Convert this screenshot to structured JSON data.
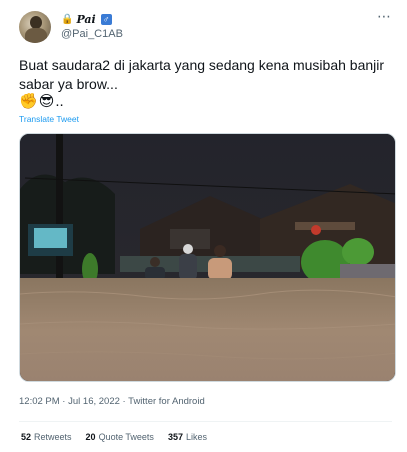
{
  "user": {
    "avatar_icon": "user-avatar-photo",
    "lock_emoji": "🔒",
    "display_name": "Pai",
    "gender_badge": "♂",
    "handle": "@Pai_C1AB"
  },
  "more_icon": "⋯",
  "tweet": {
    "text": "Buat saudara2 di jakarta yang sedang kena musibah banjir sabar ya brow...",
    "emoji_1": "✊",
    "emoji_2": "😎",
    "emoji_tail": "..",
    "translate_label": "Translate Tweet"
  },
  "meta": {
    "time": "12:02 PM",
    "separator_1": " · ",
    "date": "Jul 16, 2022",
    "separator_2": " · ",
    "source": "Twitter for Android"
  },
  "stats": {
    "retweets_count": "52",
    "retweets_label": "Retweets",
    "quotes_count": "20",
    "quotes_label": "Quote Tweets",
    "likes_count": "357",
    "likes_label": "Likes"
  },
  "colors": {
    "link": "#1d9bf0",
    "secondary_text": "#536471",
    "primary_text": "#0f1419"
  }
}
